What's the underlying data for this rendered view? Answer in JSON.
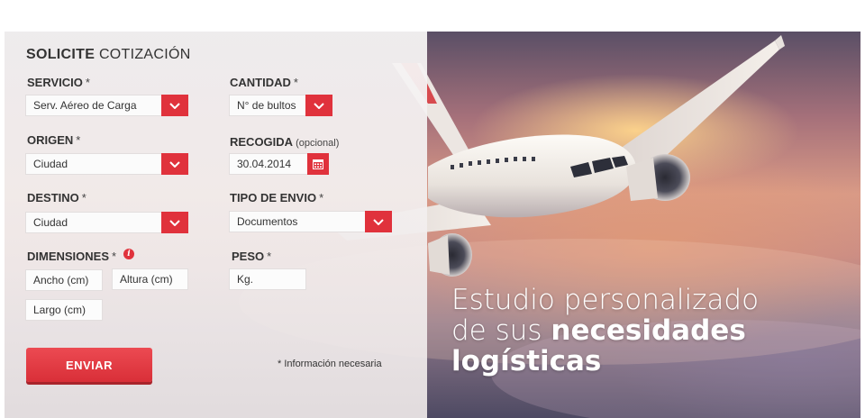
{
  "form": {
    "title_bold": "SOLICITE",
    "title_light": "COTIZACIÓN",
    "required_mark": "*",
    "servicio": {
      "label": "SERVICIO",
      "value": "Serv. Aéreo de Carga"
    },
    "cantidad": {
      "label": "CANTIDAD",
      "value": "N° de bultos"
    },
    "origen": {
      "label": "ORIGEN",
      "value": "Ciudad"
    },
    "recogida": {
      "label": "RECOGIDA",
      "optional": "(opcional)",
      "value": "30.04.2014"
    },
    "destino": {
      "label": "DESTINO",
      "value": "Ciudad"
    },
    "tipo_envio": {
      "label": "TIPO DE ENVIO",
      "value": "Documentos"
    },
    "dimensiones": {
      "label": "DIMENSIONES",
      "info_glyph": "i",
      "ancho": "Ancho (cm)",
      "altura": "Altura (cm)",
      "largo": "Largo (cm)"
    },
    "peso": {
      "label": "PESO",
      "value": "Kg."
    },
    "submit_label": "ENVIAR",
    "note": "* Información necesaria"
  },
  "hero": {
    "line1": "Estudio personalizado",
    "line2_light": "de sus",
    "line2_bold": "necesidades",
    "line3_bold": "logísticas"
  },
  "colors": {
    "accent": "#e0323c",
    "text": "#333333"
  },
  "icons": {
    "select_caret": "chevron-down-icon",
    "date_picker": "calendar-icon",
    "info": "info-icon"
  }
}
